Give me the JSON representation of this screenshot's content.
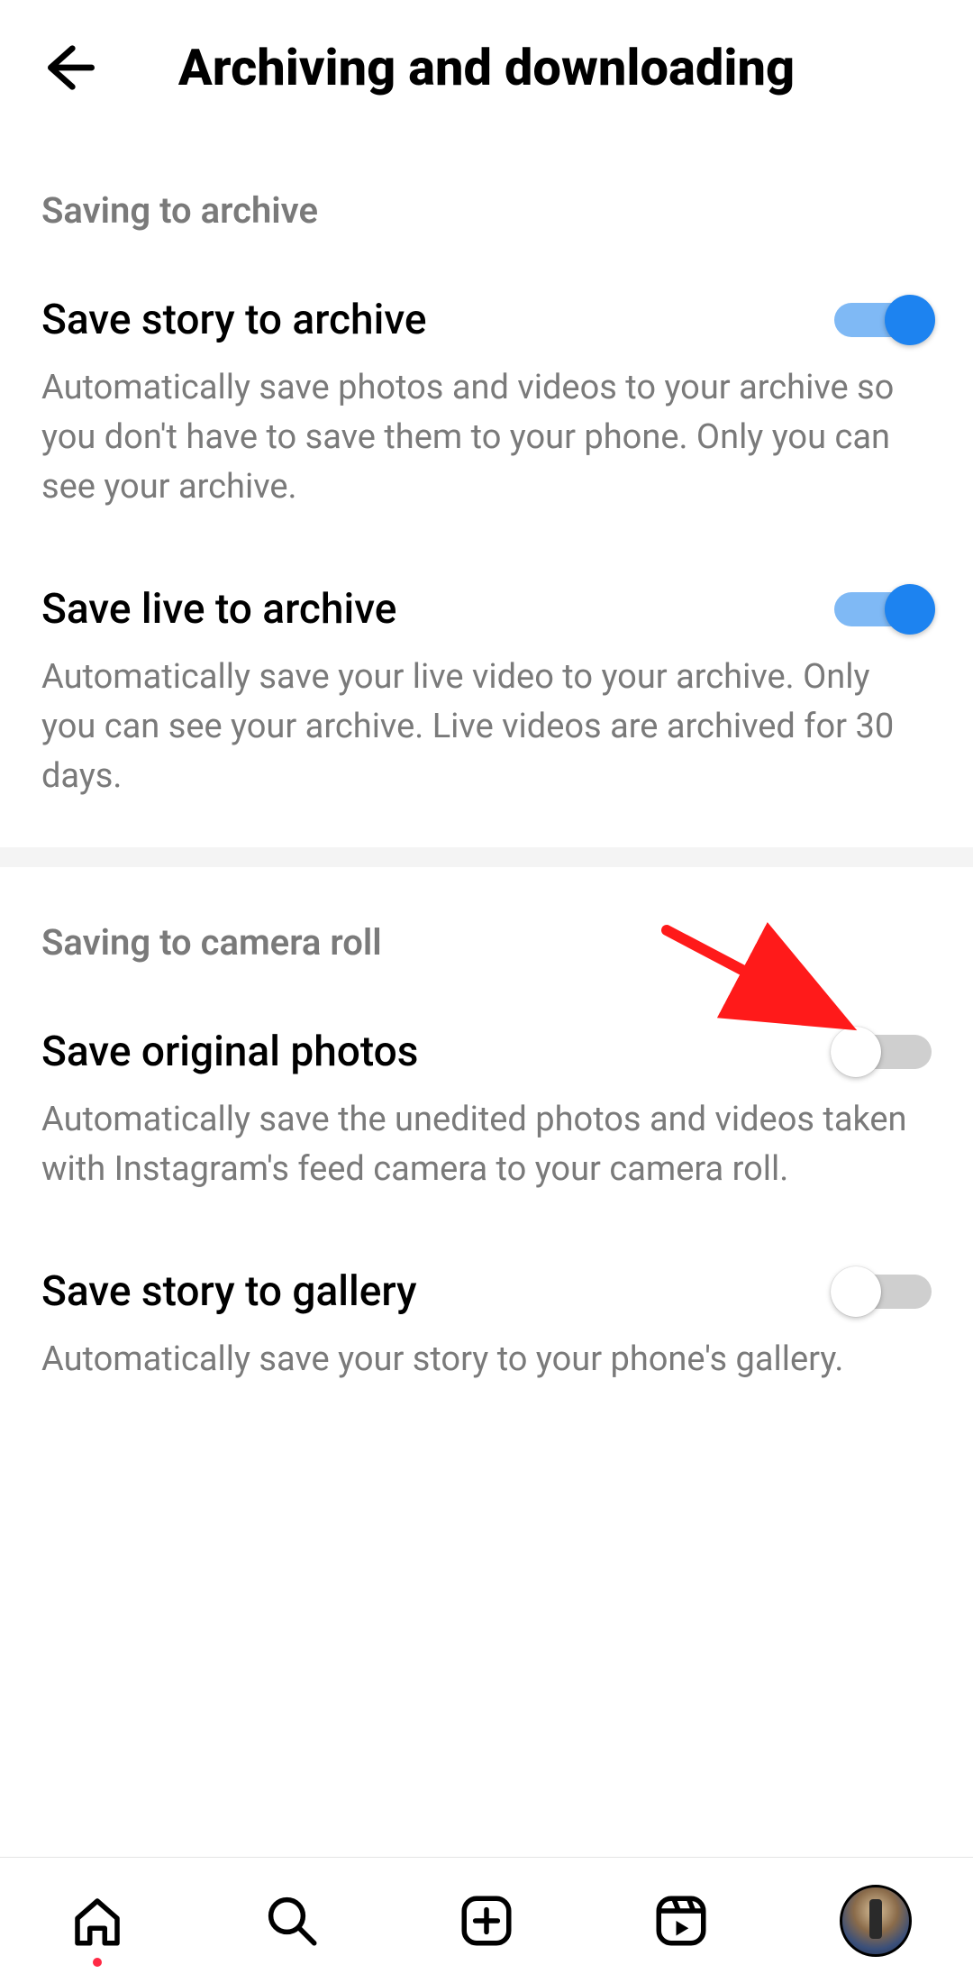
{
  "header": {
    "title": "Archiving and downloading"
  },
  "sections": [
    {
      "header": "Saving to archive",
      "items": [
        {
          "label": "Save story to archive",
          "desc": "Automatically save photos and videos to your archive so you don't have to save them to your phone. Only you can see your archive.",
          "on": true
        },
        {
          "label": "Save live to archive",
          "desc": "Automatically save your live video to your archive. Only you can see your archive. Live videos are archived for 30 days.",
          "on": true
        }
      ]
    },
    {
      "header": "Saving to camera roll",
      "items": [
        {
          "label": "Save original photos",
          "desc": "Automatically save the unedited photos and videos taken with Instagram's feed camera to your camera roll.",
          "on": false
        },
        {
          "label": "Save story to gallery",
          "desc": "Automatically save your story to your phone's gallery.",
          "on": false
        }
      ]
    }
  ],
  "annotation": {
    "arrow_color": "#ff1a1a"
  }
}
